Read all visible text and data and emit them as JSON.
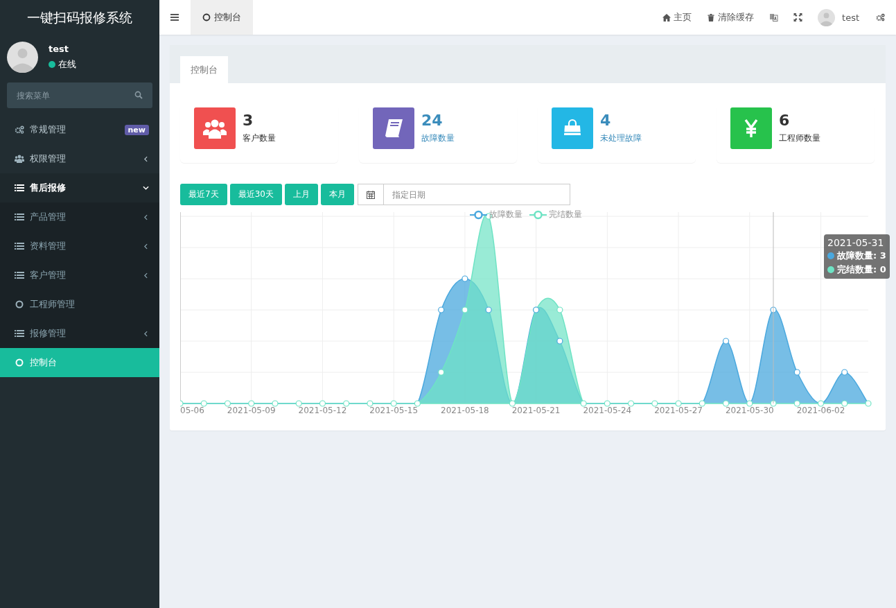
{
  "brand": "一键扫码报修系统",
  "user": {
    "name": "test",
    "status": "在线"
  },
  "sidebar": {
    "search_placeholder": "搜索菜单",
    "items": [
      {
        "label": "常规管理",
        "kind": "group",
        "badge": "new",
        "selected": false
      },
      {
        "label": "权限管理",
        "kind": "group",
        "expanded": false,
        "selected": false
      },
      {
        "label": "售后报修",
        "kind": "group",
        "expanded": true,
        "selected": false,
        "children": [
          {
            "label": "产品管理",
            "kind": "group",
            "expanded": false,
            "selected": false
          },
          {
            "label": "资料管理",
            "kind": "group",
            "expanded": false,
            "selected": false
          },
          {
            "label": "客户管理",
            "kind": "group",
            "expanded": false,
            "selected": false
          },
          {
            "label": "工程师管理",
            "kind": "page",
            "selected": false
          },
          {
            "label": "报修管理",
            "kind": "group",
            "expanded": false,
            "selected": false
          },
          {
            "label": "控制台",
            "kind": "page",
            "selected": true
          }
        ]
      }
    ]
  },
  "header": {
    "tabs": [
      {
        "label": "控制台",
        "selected": true
      }
    ],
    "links": [
      "主页",
      "清除缓存"
    ],
    "user_name": "test"
  },
  "panel": {
    "tabs": [
      {
        "label": "控制台",
        "selected": true
      }
    ],
    "stats": [
      {
        "value": "3",
        "label": "客户数量",
        "color": "#f05050",
        "kind": "plain"
      },
      {
        "value": "24",
        "label": "故障数量",
        "color": "#7266ba",
        "kind": "link"
      },
      {
        "value": "4",
        "label": "未处理故障",
        "color": "#23b7e5",
        "kind": "link"
      },
      {
        "value": "6",
        "label": "工程师数量",
        "color": "#27c24c",
        "kind": "plain"
      }
    ],
    "filters": [
      "最近7天",
      "最近30天",
      "上月",
      "本月"
    ],
    "date_placeholder": "指定日期",
    "chart": {
      "legend": [
        {
          "name": "故障数量",
          "color": "#4aa8de"
        },
        {
          "name": "完结数量",
          "color": "#6ee3c4"
        }
      ],
      "x_labels": [
        "05-06",
        "2021-05-09",
        "2021-05-12",
        "2021-05-15",
        "2021-05-18",
        "2021-05-21",
        "2021-05-24",
        "2021-05-27",
        "2021-05-30",
        "2021-06-02"
      ],
      "tooltip": {
        "title": "2021-05-31",
        "rows": [
          {
            "text": "故障数量: 3",
            "color": "#4aa8de"
          },
          {
            "text": "完结数量: 0",
            "color": "#6ee3c4"
          }
        ]
      }
    }
  }
}
